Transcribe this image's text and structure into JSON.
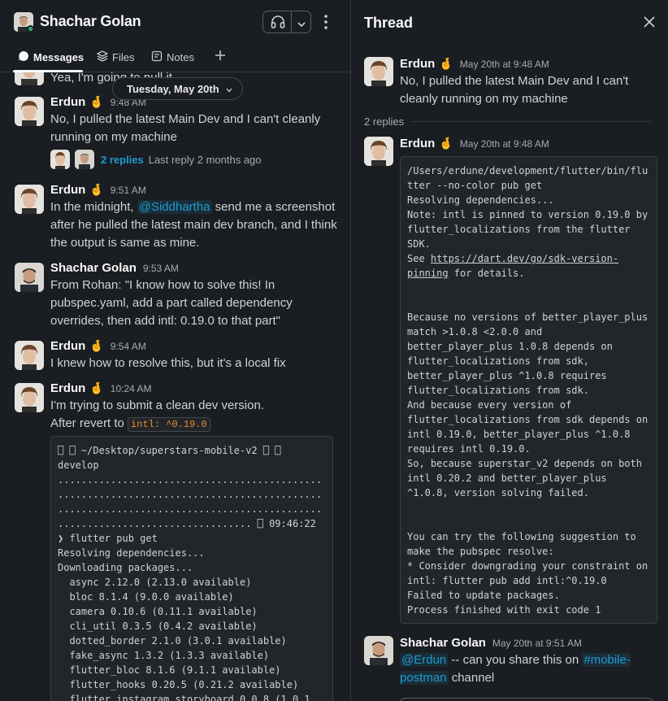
{
  "header": {
    "user_name": "Shachar Golan",
    "tabs": [
      {
        "label": "Messages"
      },
      {
        "label": "Files"
      },
      {
        "label": "Notes"
      }
    ]
  },
  "date_divider": "Tuesday, May 20th",
  "messages": [
    {
      "text_partial": "Yea, I'm going to pull it"
    },
    {
      "author": "Erdun",
      "emoji": "🤞",
      "time": "9:48 AM",
      "text": "No, I pulled the latest Main Dev and I can't cleanly running on my machine",
      "reply_count": "2 replies",
      "reply_last": "Last reply 2 months ago"
    },
    {
      "author": "Erdun",
      "emoji": "🤞",
      "time": "9:51 AM",
      "text_before": "In the midnight, ",
      "mention": "@Siddhartha",
      "text_after": " send me a screenshot after he pulled the latest main dev branch, and I think the output is same as mine."
    },
    {
      "author": "Shachar Golan",
      "time": "9:53 AM",
      "text": "From Rohan: \"I know how to solve this! In pubspec.yaml, add a part called dependency overrides, then add intl: 0.19.0 to that part\""
    },
    {
      "author": "Erdun",
      "emoji": "🤞",
      "time": "9:54 AM",
      "text": "I knew how to resolve this, but it's a local fix"
    },
    {
      "author": "Erdun",
      "emoji": "🤞",
      "time": "10:24 AM",
      "text_line1": "I'm trying to submit a clean dev version.",
      "text_line2": "After revert to ",
      "inline_code": "intl: ^0.19.0",
      "code": "⎕ ⎕ ~/Desktop/superstars-mobile-v2 ⎕ ⎕\ndevelop\n.............................................\n.............................................\n.............................................\n................................. ⎕ 09:46:22\n❯ flutter pub get\nResolving dependencies...\nDownloading packages...\n  async 2.12.0 (2.13.0 available)\n  bloc 8.1.4 (9.0.0 available)\n  camera 0.10.6 (0.11.1 available)\n  cli_util 0.3.5 (0.4.2 available)\n  dotted_border 2.1.0 (3.0.1 available)\n  fake_async 1.3.2 (1.3.3 available)\n  flutter_bloc 8.1.6 (9.1.1 available)\n  flutter_hooks 0.20.5 (0.21.2 available)\n  flutter_instagram_storyboard 0.0.8 (1.0.1"
    }
  ],
  "thread": {
    "title": "Thread",
    "parent": {
      "author": "Erdun",
      "emoji": "🤞",
      "time": "May 20th at 9:48 AM",
      "text": "No, I pulled the latest Main Dev and I can't cleanly running on my machine"
    },
    "replies_label": "2 replies",
    "reply1": {
      "author": "Erdun",
      "emoji": "🤞",
      "time": "May 20th at 9:48 AM",
      "code_head": "/Users/erdune/development/flutter/bin/flu\ntter --no-color pub get\nResolving dependencies...\nNote: intl is pinned to version 0.19.0 by\nflutter_localizations from the flutter\nSDK.\nSee ",
      "code_link": "https://dart.dev/go/sdk-version-\npinning",
      "code_tail": " for details.\n\n\nBecause no versions of better_player_plus\nmatch >1.0.8 <2.0.0 and\nbetter_player_plus 1.0.8 depends on\nflutter_localizations from sdk,\nbetter_player_plus ^1.0.8 requires\nflutter_localizations from sdk.\nAnd because every version of\nflutter_localizations from sdk depends on\nintl 0.19.0, better_player_plus ^1.0.8\nrequires intl 0.19.0.\nSo, because superstar_v2 depends on both\nintl 0.20.2 and better_player_plus\n^1.0.8, version solving failed.\n\n\nYou can try the following suggestion to\nmake the pubspec resolve:\n* Consider downgrading your constraint on\nintl: flutter pub add intl:^0.19.0\nFailed to update packages.\nProcess finished with exit code 1"
    },
    "reply2": {
      "author": "Shachar Golan",
      "time": "May 20th at 9:51 AM",
      "mention": "@Erdun",
      "text_mid": " -- can you share this on ",
      "channel_line1": "#mobile-",
      "channel_line2": "postman",
      "text_end": " channel"
    }
  }
}
